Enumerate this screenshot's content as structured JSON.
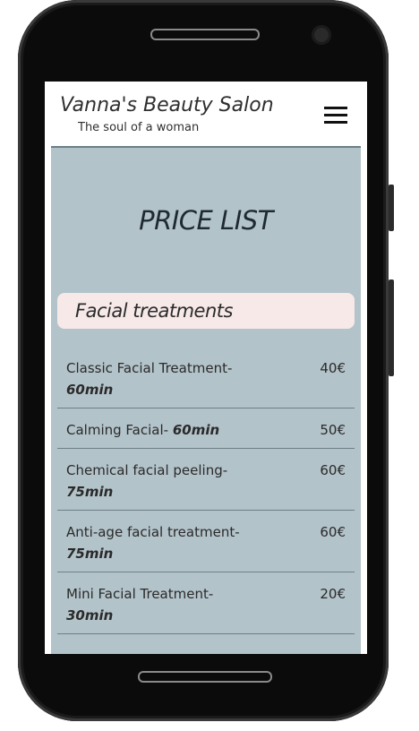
{
  "site": {
    "brand": "Vanna's Beauty Salon",
    "tagline": "The soul of a woman",
    "menu_icon": "hamburger-icon"
  },
  "page": {
    "title": "PRICE LIST"
  },
  "section": {
    "label": "Facial treatments"
  },
  "items": [
    {
      "name": "Classic Facial Treatment-",
      "duration": "60min",
      "price": "40€"
    },
    {
      "name": "Calming Facial-",
      "duration": "60min",
      "price": "50€"
    },
    {
      "name": "Chemical facial peeling-",
      "duration": "75min",
      "price": "60€"
    },
    {
      "name": "Anti-age facial treatment-",
      "duration": "75min",
      "price": "60€"
    },
    {
      "name": "Mini Facial Treatment-",
      "duration": "30min",
      "price": "20€"
    }
  ],
  "colors": {
    "content_bg": "#b3c3ca",
    "section_bg": "#f6e9e8",
    "phone_body": "#0b0b0b"
  }
}
